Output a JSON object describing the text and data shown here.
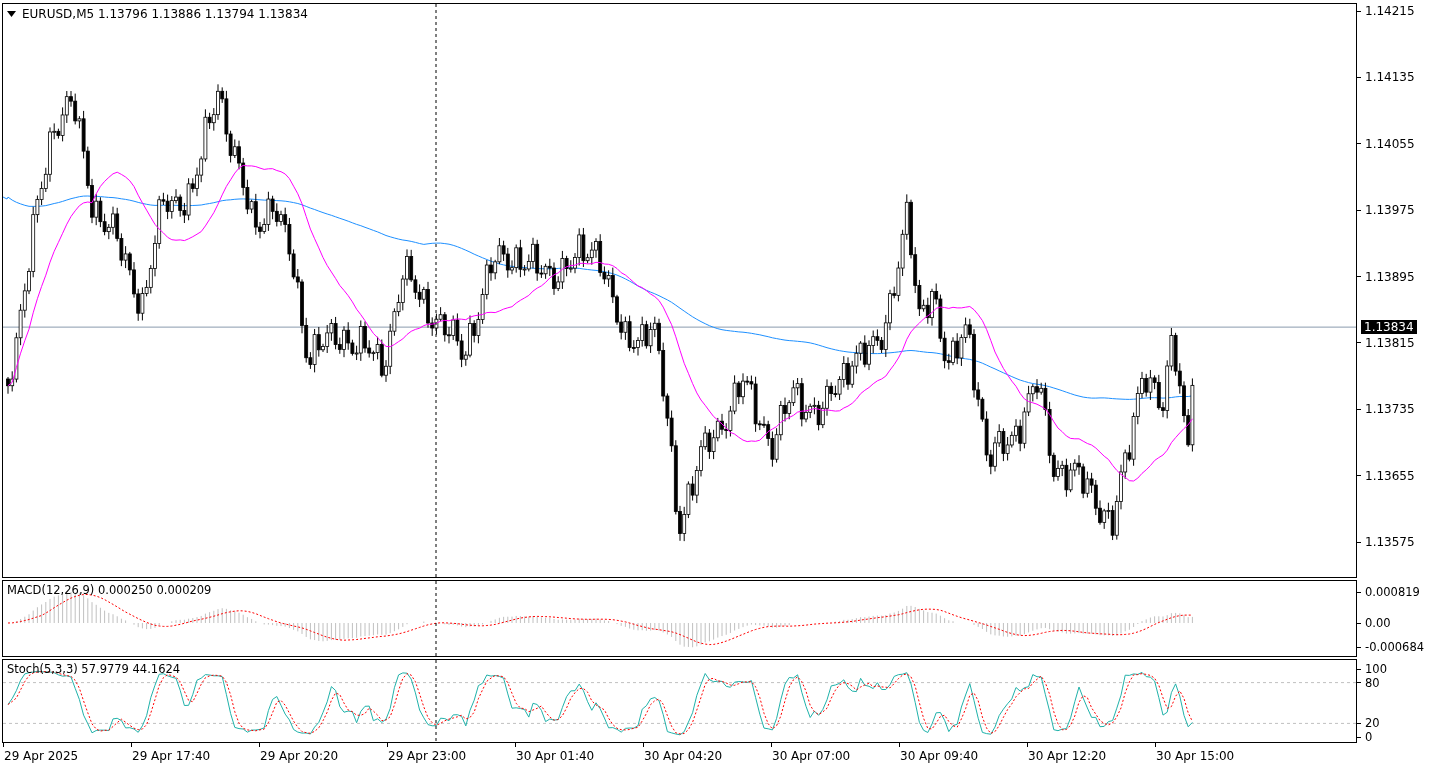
{
  "main_chart": {
    "header": "EURUSD,M5  1.13796 1.13886 1.13794 1.13834",
    "price_axis": [
      "1.14215",
      "1.14135",
      "1.14055",
      "1.13975",
      "1.13895",
      "1.13815",
      "1.13735",
      "1.13655",
      "1.13575"
    ],
    "current_price": "1.13834"
  },
  "macd": {
    "label": "MACD(12,26,9) 0.000250 0.000209",
    "axis": [
      "0.000819",
      "0.00",
      "-0.000684"
    ]
  },
  "stochastic": {
    "label": "Stoch(5,3,3) 57.9779 44.1624",
    "axis": [
      "100",
      "80",
      "20",
      "0"
    ]
  },
  "time_axis": [
    "29 Apr 2025",
    "29 Apr 17:40",
    "29 Apr 20:20",
    "29 Apr 23:00",
    "30 Apr 01:40",
    "30 Apr 04:20",
    "30 Apr 07:00",
    "30 Apr 09:40",
    "30 Apr 12:20",
    "30 Apr 15:00"
  ]
}
